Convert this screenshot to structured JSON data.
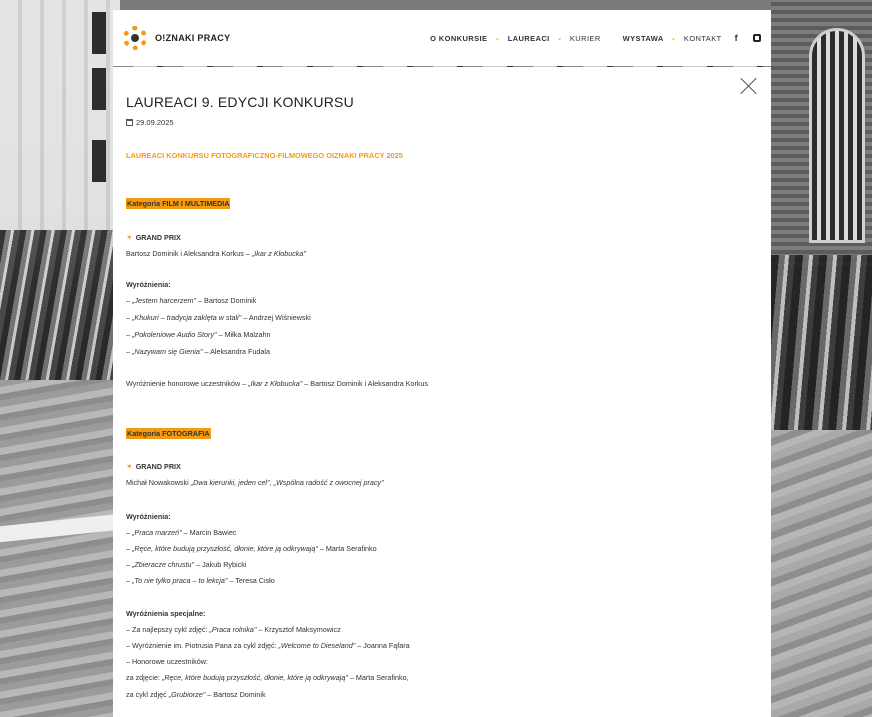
{
  "brand": {
    "name": "O!ZNAKI PRACY",
    "accent": "#f39c12"
  },
  "nav": {
    "items": [
      {
        "label": "O KONKURSIE",
        "bold": true
      },
      {
        "label": "LAUREACI",
        "bold": true
      },
      {
        "label": "KURIER",
        "bold": false
      },
      {
        "label": "WYSTAWA",
        "bold": true
      },
      {
        "label": "KONTAKT",
        "bold": false
      }
    ],
    "facebook": "f"
  },
  "article": {
    "title": "LAUREACI 9. EDYCJI KONKURSU",
    "date": "29.09.2025",
    "subtitle": "LAUREACI KONKURSU FOTOGRAFICZNO-FILMOWEGO OIZNAKI PRACY 2025",
    "film": {
      "category": "Kategoria FILM I MULTIMEDIA",
      "grand_prix_label": "GRAND PRIX",
      "grand_prix_text_a": "Bartosz Dominik i Aleksandra Korkus – ",
      "grand_prix_text_b": "„Ikar z Kłobucka\"",
      "distinctions_label": "Wyróżnienia:",
      "distinctions": [
        {
          "dash": "– ",
          "title": "„Jestem harcerzem\"",
          "rest": " – Bartosz Dominik"
        },
        {
          "dash": "– ",
          "title": "„Khukuri – tradycja zaklęta w stali\"",
          "rest": " – Andrzej Wiśniewski"
        },
        {
          "dash": "– ",
          "title": "„Pokoleniowe Audio Story\"",
          "rest": " – Miłka Malzahn"
        },
        {
          "dash": "– ",
          "title": "„Nazywam się Gienia\"",
          "rest": " – Aleksandra Fudala"
        }
      ],
      "honorable_a": "Wyróżnienie honorowe uczestników – ",
      "honorable_b": "„Ikar z Kłobucka\"",
      "honorable_c": " – Bartosz Dominik i Aleksandra Korkus"
    },
    "photo": {
      "category": "Kategoria FOTOGRAFIA",
      "grand_prix_label": "GRAND PRIX",
      "grand_prix_text_a": "Michał Nowakowski ",
      "grand_prix_text_b": "„Dwa kierunki, jeden cel\", „Wspólna radość z owocnej pracy\"",
      "distinctions_label": "Wyróżnienia:",
      "distinctions": [
        {
          "dash": "– ",
          "title": "„Praca marzeń\"",
          "rest": " – Marcin Bawiec"
        },
        {
          "dash": "– ",
          "title": "„Ręce, które budują przyszłość, dłonie, które ją odkrywają\"",
          "rest": " – Marta Serafinko"
        },
        {
          "dash": "– ",
          "title": "„Zbieracze chrustu\"",
          "rest": " – Jakub Rybicki"
        },
        {
          "dash": "– ",
          "title": "„To nie tylko praca – to lekcja\"",
          "rest": " – Teresa Cisło"
        }
      ],
      "special_label": "Wyróżnienia specjalne:",
      "special_1a": "– Za najlepszy cykl zdjęć: ",
      "special_1b": "„Praca rolnika\"",
      "special_1c": " – Krzysztof Maksymowicz",
      "special_2a": "– Wyróżnienie im. Piotrusia Pana za cykl zdjęć: ",
      "special_2b": "„Welcome to Dieseland\"",
      "special_2c": " – Joanna Fąfara",
      "special_3": "– Honorowe uczestników:",
      "special_4a": "za zdjęcie: ",
      "special_4b": "„Ręce, które budują przyszłość, dłonie, które ją odkrywają\"",
      "special_4c": " – Marta Serafinko,",
      "special_5a": "za cykl zdjęć ",
      "special_5b": "„Grubiorze\"",
      "special_5c": " – Bartosz Dominik"
    }
  }
}
